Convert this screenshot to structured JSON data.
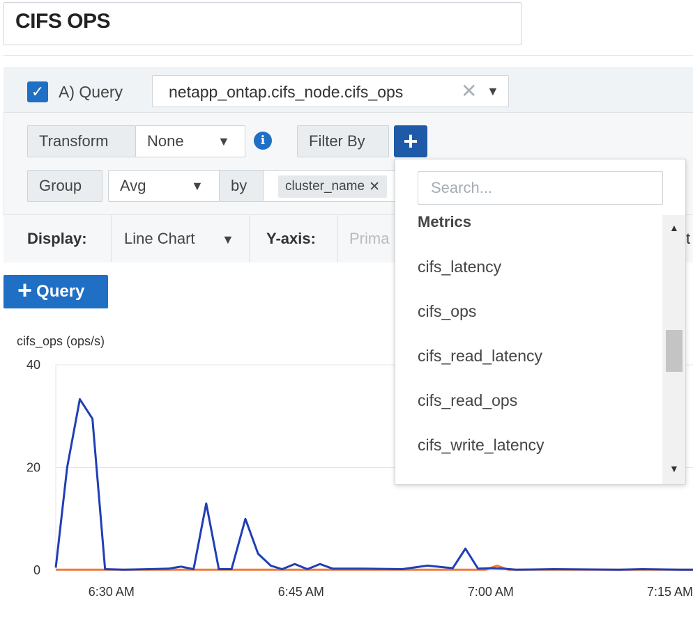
{
  "title": "CIFS OPS",
  "query": {
    "label": "A) Query",
    "metric": "netapp_ontap.cifs_node.cifs_ops",
    "transform_label": "Transform",
    "transform_value": "None",
    "filter_label": "Filter By",
    "group_label": "Group",
    "group_value": "Avg",
    "by_label": "by",
    "group_tag": "cluster_name"
  },
  "display": {
    "label": "Display:",
    "value": "Line Chart",
    "yaxis_label": "Y-axis:",
    "yaxis_value": "Prima",
    "cut_text": "t"
  },
  "add_query_label": "Query",
  "dropdown": {
    "search_placeholder": "Search...",
    "heading": "Metrics",
    "items": [
      "cifs_latency",
      "cifs_ops",
      "cifs_read_latency",
      "cifs_read_ops",
      "cifs_write_latency"
    ]
  },
  "colors": {
    "accent": "#1f6fc5",
    "series_blue": "#1f3fb5",
    "series_orange": "#f07a3a"
  },
  "icons": [
    "checkbox-checked-icon",
    "clear-x-icon",
    "chevron-down-icon",
    "info-icon",
    "plus-icon",
    "scroll-up-icon",
    "scroll-down-icon"
  ],
  "chart_data": {
    "type": "line",
    "ylabel": "cifs_ops (ops/s)",
    "ylim": [
      0,
      40
    ],
    "yticks": [
      "0",
      "20",
      "40"
    ],
    "xticks": [
      "6:30 AM",
      "6:45 AM",
      "7:00 AM",
      "7:15 AM"
    ],
    "xtick_minutes": [
      30,
      45,
      60,
      75
    ],
    "series": [
      {
        "color": "#1f3fb5",
        "points": [
          [
            25.6,
            0.5
          ],
          [
            26.5,
            20
          ],
          [
            27.5,
            33.3
          ],
          [
            28.5,
            29.5
          ],
          [
            29.5,
            0.2
          ],
          [
            31,
            0.1
          ],
          [
            33,
            0.2
          ],
          [
            34.5,
            0.3
          ],
          [
            35.5,
            0.7
          ],
          [
            36.5,
            0.2
          ],
          [
            37.5,
            13
          ],
          [
            38.5,
            0.2
          ],
          [
            39.5,
            0.2
          ],
          [
            40.6,
            10
          ],
          [
            41.6,
            3.2
          ],
          [
            42.6,
            0.9
          ],
          [
            43.5,
            0.2
          ],
          [
            44.5,
            1.2
          ],
          [
            45.5,
            0.2
          ],
          [
            46.5,
            1.2
          ],
          [
            47.5,
            0.3
          ],
          [
            50,
            0.3
          ],
          [
            53,
            0.2
          ],
          [
            55,
            0.9
          ],
          [
            57,
            0.4
          ],
          [
            58,
            4.2
          ],
          [
            59,
            0.3
          ],
          [
            60,
            0.4
          ],
          [
            61,
            0.3
          ],
          [
            62,
            0.1
          ],
          [
            65,
            0.2
          ],
          [
            70,
            0.1
          ],
          [
            72,
            0.2
          ],
          [
            75,
            0.1
          ],
          [
            76,
            0.1
          ]
        ]
      },
      {
        "color": "#f07a3a",
        "points": [
          [
            25.6,
            0.1
          ],
          [
            59.6,
            0.1
          ],
          [
            60.5,
            0.9
          ],
          [
            61.4,
            0.1
          ],
          [
            76,
            0.1
          ]
        ]
      }
    ]
  }
}
